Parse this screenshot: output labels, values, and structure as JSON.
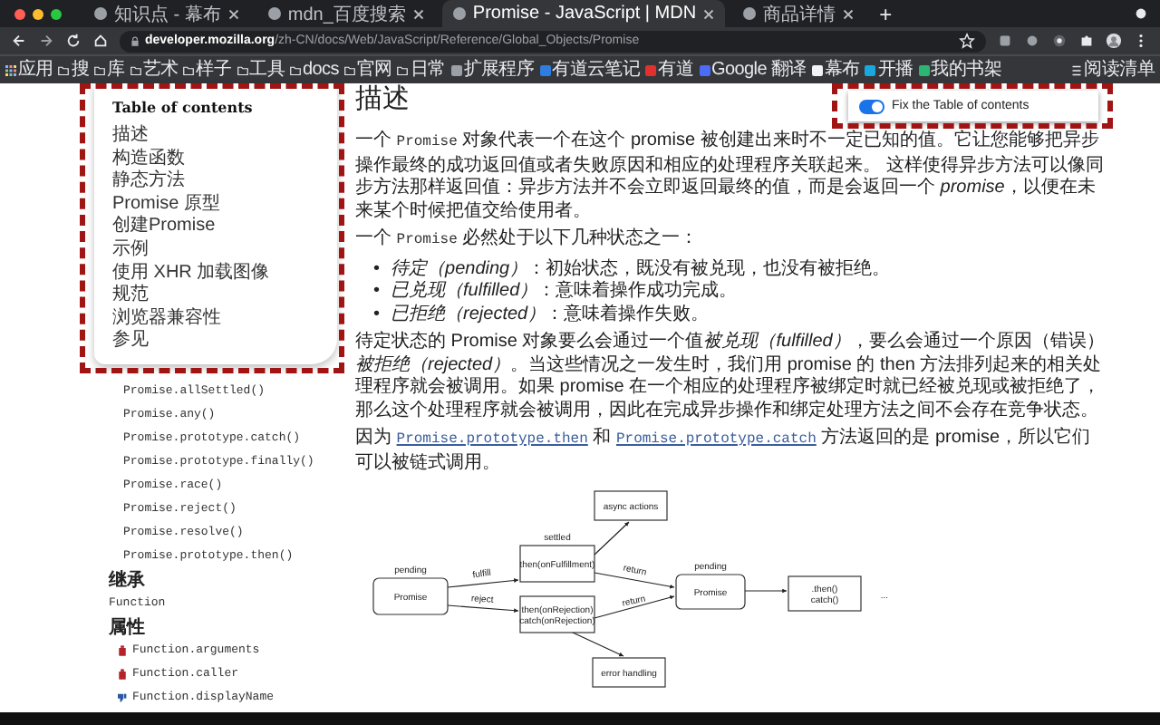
{
  "tabs": [
    {
      "title": "知识点 - 幕布",
      "selected": false
    },
    {
      "title": "mdn_百度搜索",
      "selected": false
    },
    {
      "title": "Promise - JavaScript | MDN",
      "selected": true
    },
    {
      "title": "商品详情",
      "selected": false
    }
  ],
  "new_tab": "+",
  "address": {
    "host": "developer.mozilla.org",
    "path": "/zh-CN/docs/Web/JavaScript/Reference/Global_Objects/Promise"
  },
  "bookmarks": [
    {
      "label": "应用",
      "kind": "apps"
    },
    {
      "label": "搜",
      "kind": "folder"
    },
    {
      "label": "库",
      "kind": "folder"
    },
    {
      "label": "艺术",
      "kind": "folder"
    },
    {
      "label": "样子",
      "kind": "folder"
    },
    {
      "label": "工具",
      "kind": "folder"
    },
    {
      "label": "docs",
      "kind": "folder"
    },
    {
      "label": "官网",
      "kind": "folder"
    },
    {
      "label": "日常",
      "kind": "folder"
    },
    {
      "label": "扩展程序",
      "kind": "site",
      "color": "#9aa0a6"
    },
    {
      "label": "有道云笔记",
      "kind": "site",
      "color": "#2f7de1"
    },
    {
      "label": "有道",
      "kind": "site",
      "color": "#e0312f"
    },
    {
      "label": "Google 翻译",
      "kind": "site",
      "color": "#4a6cf7"
    },
    {
      "label": "幕布",
      "kind": "site",
      "color": "#f1f3f4"
    },
    {
      "label": "开播",
      "kind": "site",
      "color": "#19a7e0"
    },
    {
      "label": "我的书架",
      "kind": "site",
      "color": "#2bb673"
    }
  ],
  "reading_list": "阅读清单",
  "popup": {
    "label": "Fix the Table of contents",
    "on": true
  },
  "toc": {
    "title": "Table of contents",
    "items": [
      "描述",
      "构造函数",
      "静态方法",
      "Promise 原型",
      "创建Promise",
      "示例",
      "使用 XHR 加载图像",
      "规范",
      "浏览器兼容性",
      "参见"
    ]
  },
  "sidebar": [
    {
      "kind": "method",
      "text": "Promise.allSettled()"
    },
    {
      "kind": "method",
      "text": "Promise.any()"
    },
    {
      "kind": "method",
      "text": "Promise.prototype.catch()"
    },
    {
      "kind": "method",
      "text": "Promise.prototype.finally()"
    },
    {
      "kind": "method",
      "text": "Promise.race()"
    },
    {
      "kind": "method",
      "text": "Promise.reject()"
    },
    {
      "kind": "method",
      "text": "Promise.resolve()"
    },
    {
      "kind": "method",
      "text": "Promise.prototype.then()"
    },
    {
      "kind": "heading",
      "text": "继承"
    },
    {
      "kind": "link",
      "text": "Function"
    },
    {
      "kind": "heading",
      "text": "属性"
    },
    {
      "kind": "deprecated",
      "text": "Function.arguments"
    },
    {
      "kind": "deprecated",
      "text": "Function.caller"
    },
    {
      "kind": "nonstandard",
      "text": "Function.displayName"
    }
  ],
  "article": {
    "heading": "描述",
    "blocks": [
      {
        "kind": "p",
        "parts": [
          {
            "kind": "text",
            "text": "一个 "
          },
          {
            "kind": "code",
            "text": "Promise"
          },
          {
            "kind": "text",
            "text": " 对象代表一个在这个 promise 被创建出来时不一定已知的值。它让您能够把异步操作最终的成功返回值或者失败原因和相应的处理程序关联起来。 这样使得异步方法可以像同步方法那样返回值：异步方法并不会立即返回最终的值，而是会返回一个 *promise*，以便在未来某个时候把值交给使用者。"
          }
        ]
      },
      {
        "kind": "p",
        "parts": [
          {
            "kind": "text",
            "text": "一个 "
          },
          {
            "kind": "code",
            "text": "Promise"
          },
          {
            "kind": "text",
            "text": " 必然处于以下几种状态之一："
          }
        ]
      },
      {
        "kind": "list",
        "marker": "•",
        "items": [
          "*待定（pending）*：初始状态，既没有被兑现，也没有被拒绝。",
          "*已兑现（fulfilled）*：意味着操作成功完成。",
          "*已拒绝（rejected）*：意味着操作失败。"
        ]
      },
      {
        "kind": "p",
        "parts": [
          {
            "kind": "text",
            "text": "待定状态的 Promise 对象要么会通过一个值"
          },
          {
            "kind": "em",
            "text": "被兑现（fulfilled）"
          },
          {
            "kind": "text",
            "text": "，要么会通过一个原因（错误）"
          },
          {
            "kind": "em",
            "text": "被拒绝（rejected）"
          },
          {
            "kind": "text",
            "text": "。当这些情况之一发生时，我们用 promise 的 then 方法排列起来的相关处理程序就会被调用。如果 promise 在一个相应的处理程序被绑定时就已经被兑现或被拒绝了，那么这个处理程序就会被调用，因此在完成异步操作和绑定处理方法之间不会存在竞争状态。"
          }
        ]
      },
      {
        "kind": "p",
        "parts": [
          {
            "kind": "text",
            "text": "因为 "
          },
          {
            "kind": "link",
            "text": "Promise.prototype.then"
          },
          {
            "kind": "text",
            "text": " 和 "
          },
          {
            "kind": "link",
            "text": "Promise.prototype.catch"
          },
          {
            "kind": "text",
            "text": " 方法返回的是 promise，所以它们可以被链式调用。"
          }
        ]
      }
    ]
  },
  "diagram": {
    "nodes": [
      {
        "lines": [
          "Promise"
        ],
        "caption": "pending"
      },
      {
        "lines": [
          "then(onFulfillment)"
        ],
        "caption": "settled"
      },
      {
        "lines": [
          "async actions"
        ]
      },
      {
        "lines": [
          "then(onRejection)",
          "catch(onRejection)"
        ]
      },
      {
        "lines": [
          "error handling"
        ]
      },
      {
        "lines": [
          "Promise"
        ],
        "caption": "pending"
      },
      {
        "lines": [
          ".then()",
          "catch()"
        ]
      }
    ],
    "edge_labels": [
      "fulfill",
      "reject",
      "return",
      "return"
    ],
    "trailing": "..."
  }
}
